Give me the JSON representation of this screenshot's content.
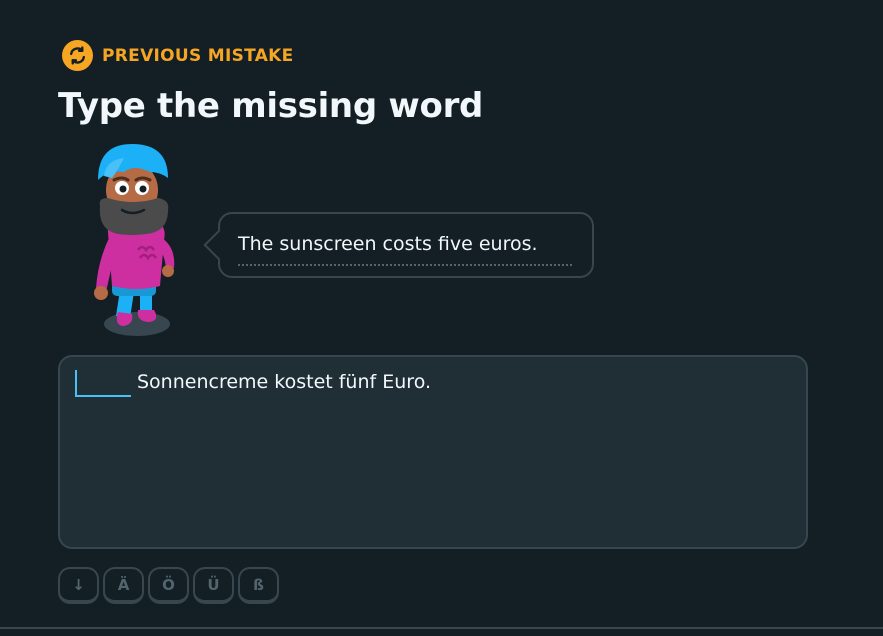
{
  "header": {
    "tag_label": "PREVIOUS MISTAKE",
    "tag_icon": "refresh-icon",
    "title": "Type the missing word"
  },
  "prompt": {
    "character_icon": "character-illustration",
    "speech": "The sunscreen costs five euros."
  },
  "answer": {
    "blank_value": "",
    "sentence": "Sonnencreme kostet fünf Euro."
  },
  "keyboard": {
    "toggle": "↓",
    "keys": [
      "Ä",
      "Ö",
      "Ü",
      "ß"
    ]
  },
  "colors": {
    "background": "#131f24",
    "accent": "#f6a623",
    "border": "#37464f",
    "input_focus": "#49c0f8",
    "text": "#f1f7fb"
  }
}
